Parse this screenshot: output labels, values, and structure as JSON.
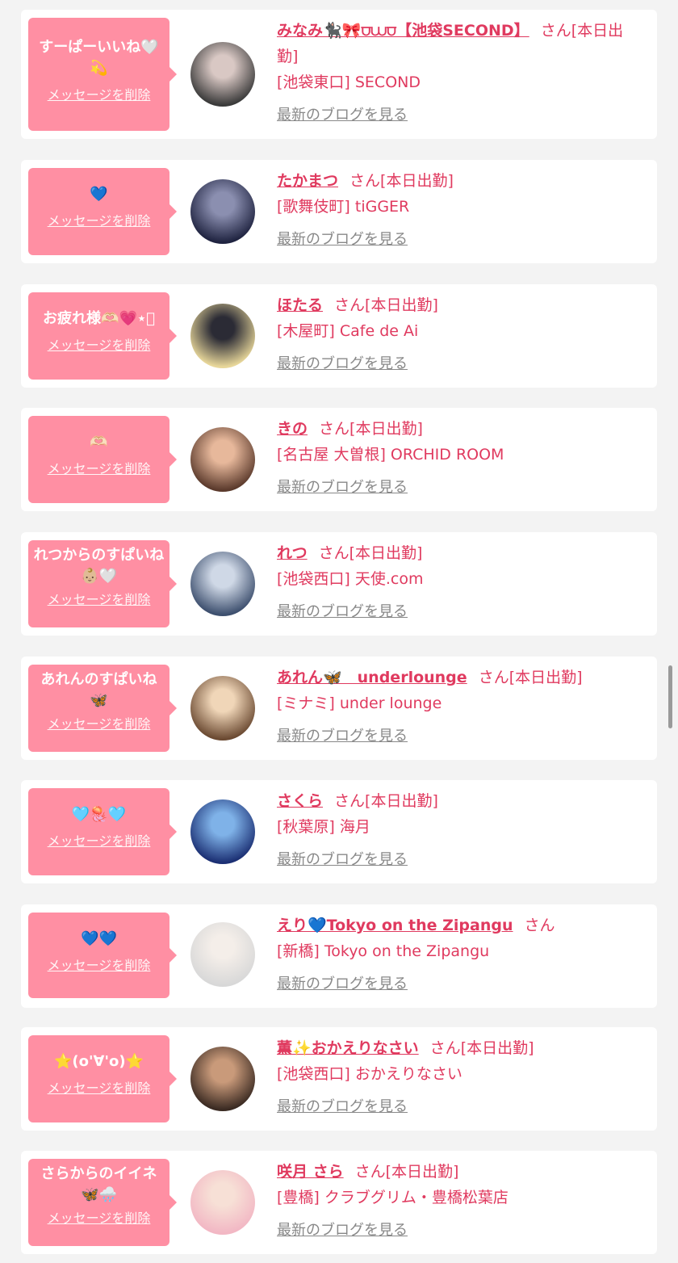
{
  "items": [
    {
      "message": "すーぱーいいね🤍💫",
      "delete_label": "メッセージを削除",
      "name": "みなみ🐈‍⬛🎀⩌⩊⩌【池袋SECOND】",
      "san": "さん",
      "attendance": "[本日出勤]",
      "shop": "[池袋東口] SECOND",
      "blog_label": "最新のブログを見る",
      "avatar_colors": [
        "#3a3a3a",
        "#d9c8c4"
      ]
    },
    {
      "message": "💙",
      "delete_label": "メッセージを削除",
      "name": "たかまつ",
      "san": "さん",
      "attendance": "[本日出勤]",
      "shop": "[歌舞伎町] tiGGER",
      "blog_label": "最新のブログを見る",
      "avatar_colors": [
        "#1f2340",
        "#8b8fb0"
      ]
    },
    {
      "message": "お疲れ様🫶🏻💗⋆͛",
      "delete_label": "メッセージを削除",
      "name": "ほたる",
      "san": "さん",
      "attendance": "[本日出勤]",
      "shop": "[木屋町] Cafe de Ai",
      "blog_label": "最新のブログを見る",
      "avatar_colors": [
        "#e8d79a",
        "#2b2b35"
      ]
    },
    {
      "message": "🫶🏻",
      "delete_label": "メッセージを削除",
      "name": "きの",
      "san": "さん",
      "attendance": "[本日出勤]",
      "shop": "[名古屋 大曽根] ORCHID ROOM",
      "blog_label": "最新のブログを見る",
      "avatar_colors": [
        "#5b3a2c",
        "#e7b89b"
      ]
    },
    {
      "message": "れつからのすぱいね👶🏼🤍",
      "delete_label": "メッセージを削除",
      "name": "れつ",
      "san": "さん",
      "attendance": "[本日出勤]",
      "shop": "[池袋西口] 天使.com",
      "blog_label": "最新のブログを見る",
      "avatar_colors": [
        "#3d4f6e",
        "#cfd8e6"
      ]
    },
    {
      "message": "あれんのすぱいね🦋",
      "delete_label": "メッセージを削除",
      "name": "あれん🦋　underlounge",
      "san": "さん",
      "attendance": "[本日出勤]",
      "shop": "[ミナミ] under lounge",
      "blog_label": "最新のブログを見る",
      "avatar_colors": [
        "#6b4a32",
        "#f0d6b8"
      ]
    },
    {
      "message": "🩵🪼🩵",
      "delete_label": "メッセージを削除",
      "name": "さくら",
      "san": "さん",
      "attendance": "[本日出勤]",
      "shop": "[秋葉原] 海月",
      "blog_label": "最新のブログを見る",
      "avatar_colors": [
        "#1b2f73",
        "#7fb2e8"
      ]
    },
    {
      "message": "💙💙",
      "delete_label": "メッセージを削除",
      "name": "えり💙Tokyo on the Zipangu",
      "san": "さん",
      "attendance": "",
      "shop": "[新橋] Tokyo on the Zipangu",
      "blog_label": "最新のブログを見る",
      "avatar_colors": [
        "#d8d8d8",
        "#f4eee9"
      ]
    },
    {
      "message": "⭐️(o'∀'o)⭐️",
      "delete_label": "メッセージを削除",
      "name": "薫✨おかえりなさい",
      "san": "さん",
      "attendance": "[本日出勤]",
      "shop": "[池袋西口] おかえりなさい",
      "blog_label": "最新のブログを見る",
      "avatar_colors": [
        "#3a2a22",
        "#c99a7a"
      ]
    },
    {
      "message": "さらからのイイネ🦋🌧️",
      "delete_label": "メッセージを削除",
      "name": "咲月 さら",
      "san": "さん",
      "attendance": "[本日出勤]",
      "shop": "[豊橋] クラブグリム・豊橋松葉店",
      "blog_label": "最新のブログを見る",
      "avatar_colors": [
        "#f2b7c4",
        "#f7e0d6"
      ]
    }
  ]
}
